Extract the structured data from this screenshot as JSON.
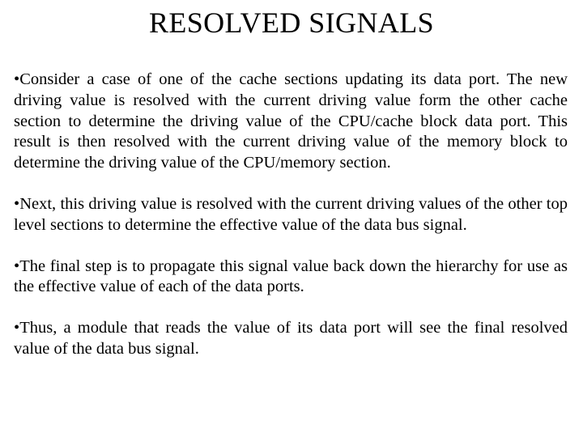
{
  "slide": {
    "title": "RESOLVED SIGNALS",
    "background_color": "#ffffff",
    "text_color": "#000000",
    "bullet_glyph": "•",
    "paragraphs": [
      {
        "bullet": "•",
        "text": "Consider a case of one of the cache sections updating its data port. The new driving value is resolved with the current driving value form the other cache section to determine the driving value of the CPU/cache block data port. This result is then resolved with the current driving value of the memory block to determine the driving value of the CPU/memory section."
      },
      {
        "bullet": "•",
        "text": "Next, this driving value is resolved with the current driving values of the other top level sections to determine the effective value of the data bus signal."
      },
      {
        "bullet": "•",
        "text": "The final step is to propagate this signal value back down the hierarchy for use as the effective value of each of the data ports."
      },
      {
        "bullet": "•",
        "text": "Thus, a module that reads the value of its data port will see the final resolved value of the data bus signal."
      }
    ]
  }
}
